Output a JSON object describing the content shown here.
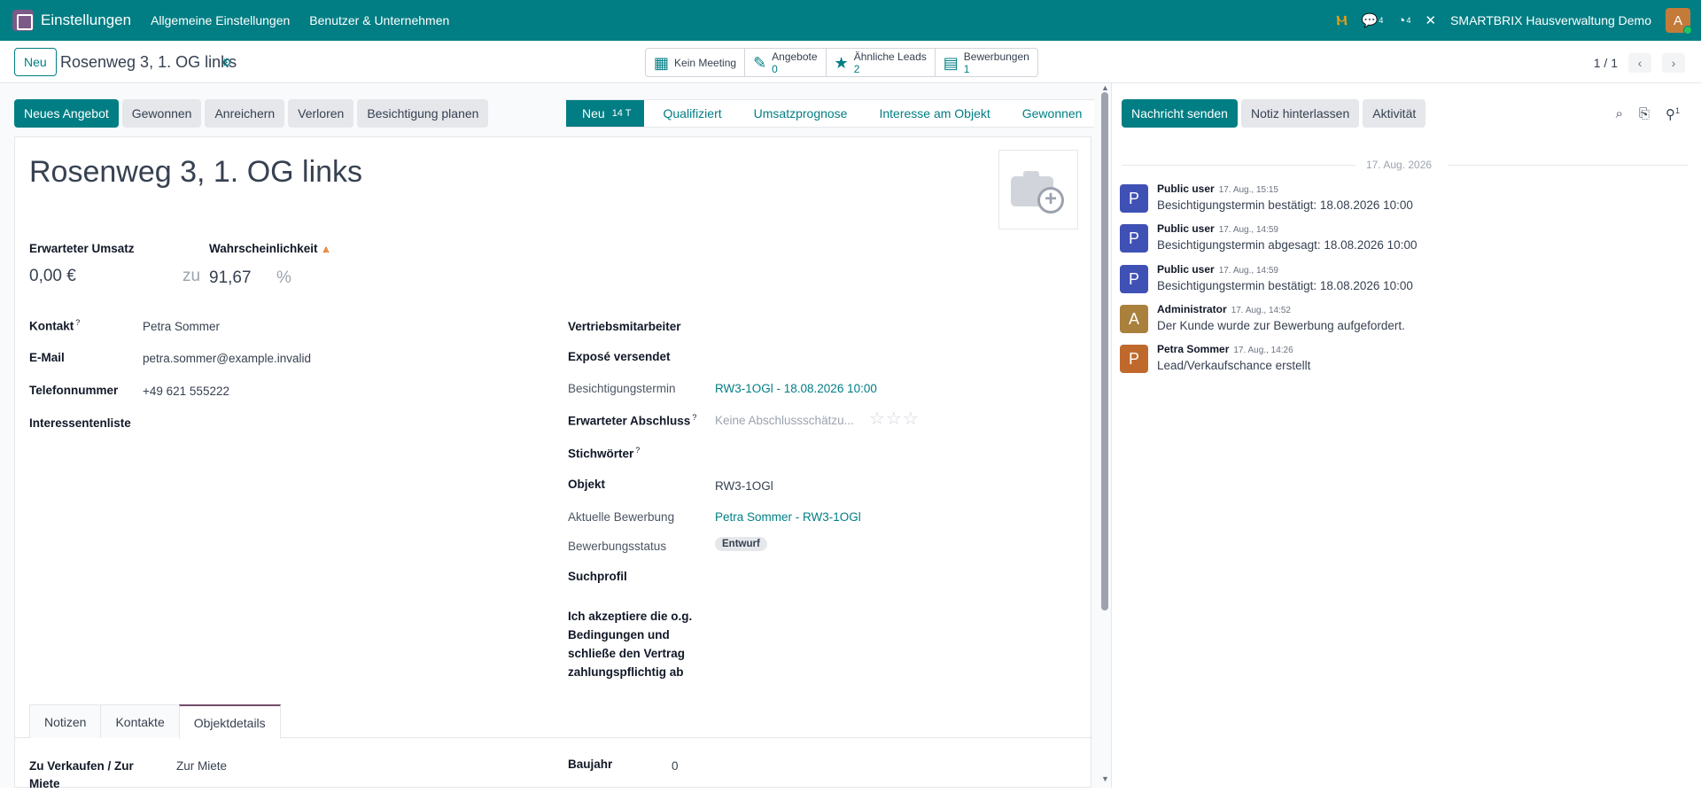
{
  "navbar": {
    "app_name": "Einstellungen",
    "menu": [
      "Allgemeine Einstellungen",
      "Benutzer & Unternehmen"
    ],
    "messages_count": "4",
    "activities_count": "4",
    "company": "SMARTBRIX Hausverwaltung Demo",
    "avatar_letter": "A"
  },
  "control": {
    "new_label": "Neu",
    "record_name": "Rosenweg 3, 1. OG links",
    "smart_buttons": [
      {
        "label": "Kein Meeting",
        "value": ""
      },
      {
        "label": "Angebote",
        "value": "0"
      },
      {
        "label": "Ähnliche Leads",
        "value": "2"
      },
      {
        "label": "Bewerbungen",
        "value": "1"
      }
    ],
    "pager": "1 / 1"
  },
  "actions": [
    "Neues Angebot",
    "Gewonnen",
    "Anreichern",
    "Verloren",
    "Besichtigung planen"
  ],
  "stages": [
    {
      "label": "Neu",
      "days": "14 T",
      "current": true
    },
    {
      "label": "Qualifiziert"
    },
    {
      "label": "Umsatzprognose"
    },
    {
      "label": "Interesse am Objekt"
    },
    {
      "label": "Gewonnen"
    }
  ],
  "form": {
    "title": "Rosenweg 3, 1. OG links",
    "expected_revenue_label": "Erwarteter Umsatz",
    "expected_revenue": "0,00 €",
    "probability_label": "Wahrscheinlichkeit",
    "at_label": "zu",
    "probability": "91,67",
    "percent": "%",
    "left_fields": [
      {
        "label": "Kontakt",
        "value": "Petra Sommer"
      },
      {
        "label": "E-Mail",
        "value": "petra.sommer@example.invalid"
      },
      {
        "label": "Telefonnummer",
        "value": "+49 621 555222"
      },
      {
        "label": "Interessentenliste",
        "value": ""
      }
    ],
    "salesperson_label": "Vertriebsmitarbeiter",
    "expose_label": "Exposé versendet",
    "viewing_label": "Besichtigungstermin",
    "viewing_value": "RW3-1OGl - 18.08.2026 10:00",
    "closing_label": "Erwarteter Abschluss",
    "closing_placeholder": "Keine Abschlussschätzu...",
    "tags_label": "Stichwörter",
    "object_label": "Objekt",
    "object_value": "RW3-1OGl",
    "application_label": "Aktuelle Bewerbung",
    "application_value": "Petra Sommer - RW3-1OGl",
    "app_status_label": "Bewerbungsstatus",
    "app_status_value": "Entwurf",
    "search_profile_label": "Suchprofil",
    "terms_label": [
      "Ich akzeptiere die o.g.",
      "Bedingungen und",
      "schließe den Vertrag",
      "zahlungspflichtig ab"
    ],
    "tip": "?"
  },
  "tabs": [
    "Notizen",
    "Kontakte",
    "Objektdetails"
  ],
  "details": {
    "sale_rent_label": [
      "Zu Verkaufen / Zur",
      "Miete"
    ],
    "sale_rent_value": "Zur Miete",
    "year_label": "Baujahr",
    "year_value": "0"
  },
  "chatter": {
    "buttons": [
      "Nachricht senden",
      "Notiz hinterlassen",
      "Aktivität"
    ],
    "follower_count": "1",
    "date": "17. Aug. 2026",
    "messages": [
      {
        "author": "Public user",
        "time": "17. Aug., 15:15",
        "body": "Besichtigungstermin bestätigt: 18.08.2026 10:00",
        "initial": "P",
        "color": "#3f51b5"
      },
      {
        "author": "Public user",
        "time": "17. Aug., 14:59",
        "body": "Besichtigungstermin abgesagt: 18.08.2026 10:00",
        "initial": "P",
        "color": "#3f51b5"
      },
      {
        "author": "Public user",
        "time": "17. Aug., 14:59",
        "body": "Besichtigungstermin bestätigt: 18.08.2026 10:00",
        "initial": "P",
        "color": "#3f51b5"
      },
      {
        "author": "Administrator",
        "time": "17. Aug., 14:52",
        "body": "Der Kunde wurde zur Bewerbung aufgefordert.",
        "initial": "A",
        "color": "#a9803c"
      },
      {
        "author": "Petra Sommer",
        "time": "17. Aug., 14:26",
        "body": "Lead/Verkaufschance erstellt",
        "initial": "P",
        "color": "#c0692c"
      }
    ]
  },
  "colors": {
    "brand": "#017e84",
    "accent": "#714b67"
  }
}
